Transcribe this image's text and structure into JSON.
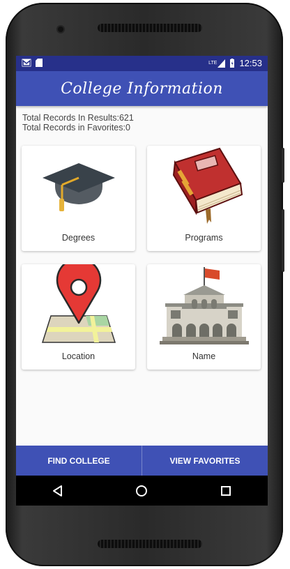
{
  "status_bar": {
    "time": "12:53",
    "network": "LTE"
  },
  "app_bar": {
    "title": "College Information"
  },
  "totals": {
    "results": "Total Records In Results:621",
    "favorites": "Total Records in Favorites:0"
  },
  "categories": [
    {
      "label": "Degrees",
      "icon": "graduation-cap-icon"
    },
    {
      "label": "Programs",
      "icon": "book-icon"
    },
    {
      "label": "Location",
      "icon": "map-pin-icon"
    },
    {
      "label": "Name",
      "icon": "college-building-icon"
    }
  ],
  "bottom_bar": {
    "find_label": "FIND COLLEGE",
    "favorites_label": "VIEW FAVORITES"
  },
  "colors": {
    "primary": "#3f51b5",
    "primary_dark": "#27308a"
  }
}
